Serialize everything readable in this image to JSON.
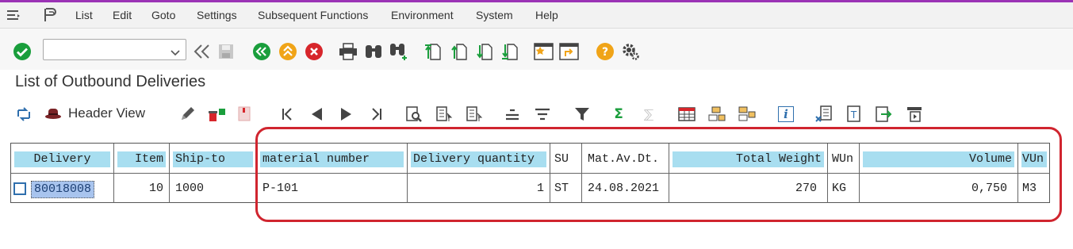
{
  "menu": {
    "items": [
      "List",
      "Edit",
      "Goto",
      "Settings",
      "Subsequent Functions",
      "Environment",
      "System",
      "Help"
    ]
  },
  "toolbar": {
    "command_field_value": "",
    "icons": [
      "enter-icon",
      "back-icon",
      "save-icon",
      "back-green-icon",
      "exit-icon",
      "cancel-icon",
      "print-icon",
      "find-icon",
      "find-next-icon",
      "first-page-icon",
      "prev-page-icon",
      "next-page-icon",
      "last-page-icon",
      "new-session-icon",
      "shortcut-icon",
      "help-icon",
      "settings-icon"
    ]
  },
  "page": {
    "title": "List of Outbound Deliveries"
  },
  "app_toolbar": {
    "header_view_label": "Header View",
    "sum_symbol": "Σ",
    "subtotal_symbol": "⅀",
    "info_symbol": "i"
  },
  "table": {
    "columns": [
      "Delivery",
      "Item",
      "Ship-to",
      "material number",
      "Delivery quantity",
      "SU",
      "Mat.Av.Dt.",
      "Total Weight",
      "WUn",
      "Volume",
      "VUn"
    ],
    "rows": [
      {
        "delivery": "80018008",
        "item": "10",
        "ship_to": "1000",
        "material_number": "P-101",
        "delivery_quantity": "1",
        "su": "ST",
        "mat_av_dt": "24.08.2021",
        "total_weight": "270",
        "wun": "KG",
        "volume": "0,750",
        "vun": "M3"
      }
    ]
  },
  "colors": {
    "accent_line": "#9b33b5",
    "header_cell": "#a8def0",
    "selected_cell": "#a8c4ee",
    "highlight_box": "#d0252f",
    "enter_green": "#1a9e3c",
    "cancel_red": "#d7262b",
    "exit_orange": "#f0a418"
  }
}
